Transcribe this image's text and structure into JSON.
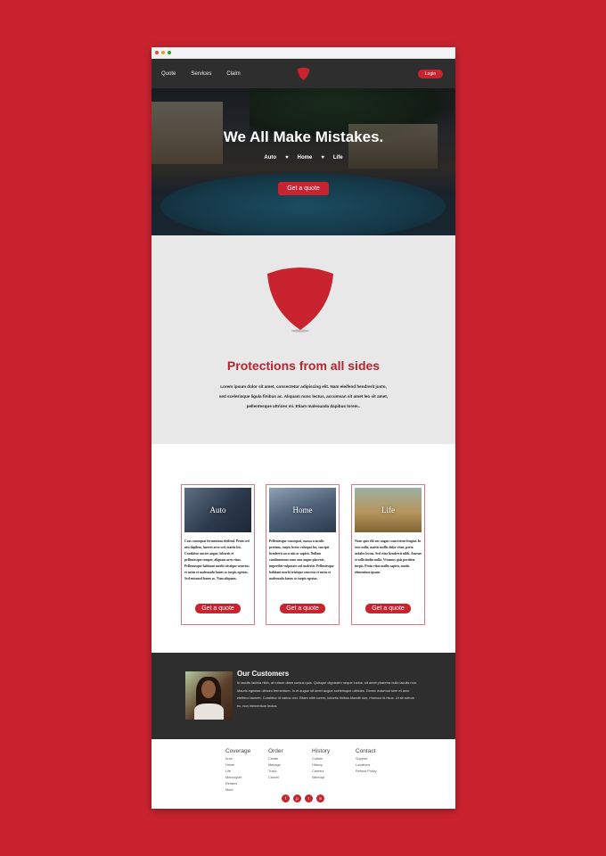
{
  "nav": {
    "links": [
      "Quote",
      "Services",
      "Claim"
    ],
    "login": "Login"
  },
  "hero": {
    "title": "We All Make Mistakes.",
    "tabs": [
      "Auto",
      "Home",
      "Life"
    ],
    "cta": "Get a quote"
  },
  "protect": {
    "title": "Protections from all sides",
    "lines": [
      "Lorem ipsum dolor sit amet, consectetur adipiscing elit. Nam eleifend hendrerit justo,",
      "sed scelerisque ligula finibus ac. Aliquam nunc lectus, accumsan sit amet leo sit amet,",
      "pellentesque ultrices mi. Etiam malesuada dapibus lorem.."
    ]
  },
  "cards": [
    {
      "title": "Auto",
      "text": "Cras consequat fermentum eleifend. Proin sed nisi dapibus, laoreet arcu sed, mattis leo. Curabitur auctor augue, lobortis et pellentesque semper, aliquam arcu risus. Pellentesque habitant morbi tristique senectus et netus et malesuada fames ac turpis egestas. Sed euismod fames ac. Nam aliquam.",
      "cta": "Get a quote"
    },
    {
      "title": "Home",
      "text": "Pellentesque consequat, massa a iaculis pretium, turpis lectus volutpat leo, suscipit hendrerit arcu nisi ac sapien. Nullam condimentum nunc non augue placerat, imperdiet vulputate sed molestie. Pellentesque habitant morbi tristique senectus et netus et malesuada fames ac turpis egestas.",
      "cta": "Get a quote"
    },
    {
      "title": "Life",
      "text": "Nunc quis elit nec augue consectetur feugiat. In eros nulla, mattis mollis dolor vitae, porta sodales lectus. Sed vitae hendrerit nibh. Aenean et sollicitudin nulla. Vivamus quis porttitor turpis. Proin vitae mollis sapien, mattis elementum ipsum.",
      "cta": "Get a quote"
    }
  ],
  "customers": {
    "title": "Our Customers",
    "text": "In iaculis lacinia nibh, at rutrum diam cursus quis. Quisque dignissim neque luctus, sit amet pharetra nulla iaculis non. Mauris egestas ultrices fermentum. In et augue sit amet augue scelerisque ultricies. Donec euismod sem et arcu eleifend laoreet. Curabitur id varius orci. Etiam nibh lorem, lobortis finibus blandit non, rhoncus id risus. Ut sit rutrum ex, non elementum lectus."
  },
  "footer": {
    "columns": [
      {
        "title": "Coverage",
        "items": [
          "Auto",
          "Home",
          "Life",
          "Motorcycle",
          "Renters",
          "More"
        ]
      },
      {
        "title": "Order",
        "items": [
          "Create",
          "Manage",
          "Track",
          "Cancel"
        ]
      },
      {
        "title": "History",
        "items": [
          "Culture",
          "History",
          "Careers",
          "Sitemap"
        ]
      },
      {
        "title": "Contact",
        "items": [
          "Support",
          "Locations",
          "Refund Policy"
        ]
      }
    ],
    "social": [
      "f",
      "p",
      "t",
      "in"
    ]
  },
  "colors": {
    "accent": "#c8232f",
    "dark": "#2e2e2e",
    "light_gray": "#e8e8e8"
  }
}
